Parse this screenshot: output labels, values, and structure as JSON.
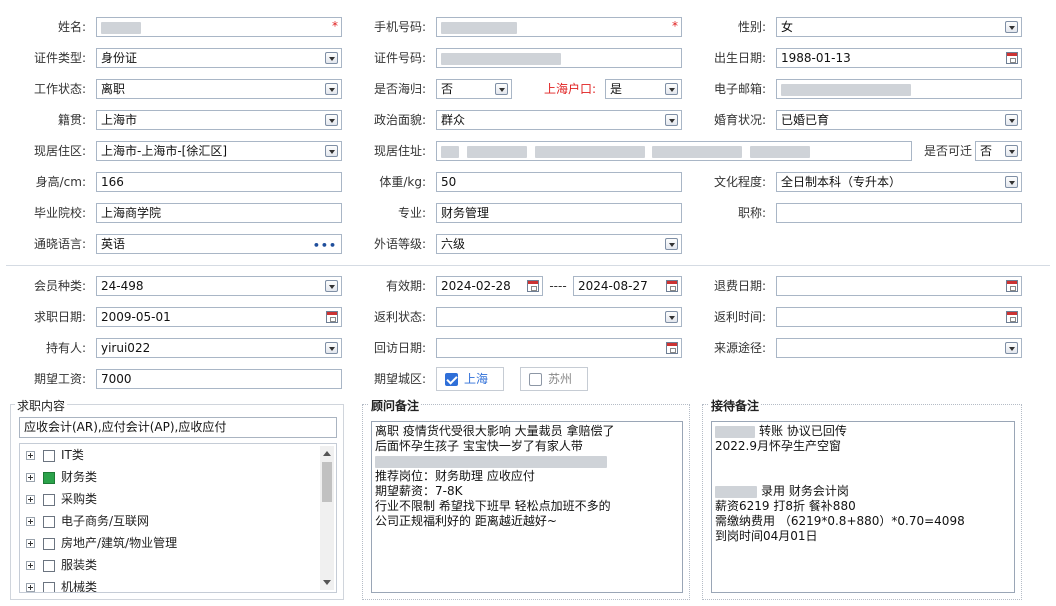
{
  "labels": {
    "name": "姓名:",
    "phone": "手机号码:",
    "gender": "性别:",
    "id_type": "证件类型:",
    "id_number": "证件号码:",
    "birth_date": "出生日期:",
    "work_status": "工作状态:",
    "overseas": "是否海归:",
    "shanghai_hukou": "上海户口:",
    "email": "电子邮箱:",
    "native_place": "籍贯:",
    "political": "政治面貌:",
    "marital": "婚育状况:",
    "current_area": "现居住区:",
    "current_address": "现居住址:",
    "relocatable": "是否可迁",
    "height": "身高/cm:",
    "weight": "体重/kg:",
    "education": "文化程度:",
    "school": "毕业院校:",
    "major": "专业:",
    "title": "职称:",
    "language": "通晓语言:",
    "foreign_level": "外语等级:",
    "member_type": "会员种类:",
    "validity": "有效期:",
    "refund_date": "退费日期:",
    "job_date": "求职日期:",
    "rebate_status": "返利状态:",
    "rebate_time": "返利时间:",
    "holder": "持有人:",
    "visit_date": "回访日期:",
    "source": "来源途径:",
    "expected_salary": "期望工资:",
    "expected_city": "期望城区:"
  },
  "values": {
    "gender": "女",
    "id_type": "身份证",
    "birth_date": "1988-01-13",
    "work_status": "离职",
    "overseas": "否",
    "shanghai_hukou": "是",
    "native_place": "上海市",
    "political": "群众",
    "marital": "已婚已育",
    "current_area": "上海市-上海市-[徐汇区]",
    "relocatable": "否",
    "height": "166",
    "weight": "50",
    "education": "全日制本科（专升本）",
    "school": "上海商学院",
    "major": "财务管理",
    "title": "",
    "language": "英语",
    "foreign_level": "六级",
    "member_type": "24-498",
    "validity_start": "2024-02-28",
    "validity_sep": "----",
    "validity_end": "2024-08-27",
    "refund_date": "",
    "job_date": "2009-05-01",
    "rebate_status": "",
    "rebate_time": "",
    "holder": "yirui022",
    "visit_date": "",
    "source": "",
    "expected_salary": "7000"
  },
  "required_mark": "*",
  "cities": [
    {
      "label": "上海",
      "checked": true
    },
    {
      "label": "苏州",
      "checked": false
    }
  ],
  "job_content": {
    "title": "求职内容",
    "selected": "应收会计(AR),应付会计(AP),应收应付",
    "tree": [
      {
        "label": "IT类",
        "checked": false
      },
      {
        "label": "财务类",
        "checked": true
      },
      {
        "label": "采购类",
        "checked": false
      },
      {
        "label": "电子商务/互联网",
        "checked": false
      },
      {
        "label": "房地产/建筑/物业管理",
        "checked": false
      },
      {
        "label": "服装类",
        "checked": false
      },
      {
        "label": "机械类",
        "checked": false
      }
    ]
  },
  "advisor_notes": {
    "title": "顾问备注",
    "lines": [
      "离职 疫情货代受很大影响 大量裁员 拿赔偿了",
      "后面怀孕生孩子 宝宝快一岁了有家人带",
      "",
      "推荐岗位：财务助理 应收应付",
      "期望薪资：7-8K",
      "行业不限制 希望找下班早 轻松点加班不多的",
      "公司正规福利好的  距离越近越好~"
    ]
  },
  "reception_notes": {
    "title": "接待备注",
    "line1_suffix": "转账  协议已回传",
    "line2": "2022.9月怀孕生产空窗",
    "line5_suffix": "录用   财务会计岗",
    "line6": "薪资6219 打8折 餐补880",
    "line7": "需缴纳费用  （6219*0.8+880）*0.70=4098",
    "line8": "到岗时间04月01日"
  },
  "colors": {
    "border": "#a9b6c6",
    "required": "#e02020",
    "accent": "#2f6fd8",
    "checked_green": "#2ba24a"
  },
  "icons": {
    "dropdown": "chevron-down-icon",
    "calendar": "calendar-icon",
    "more": "ellipsis-icon",
    "expand": "plus-icon"
  }
}
